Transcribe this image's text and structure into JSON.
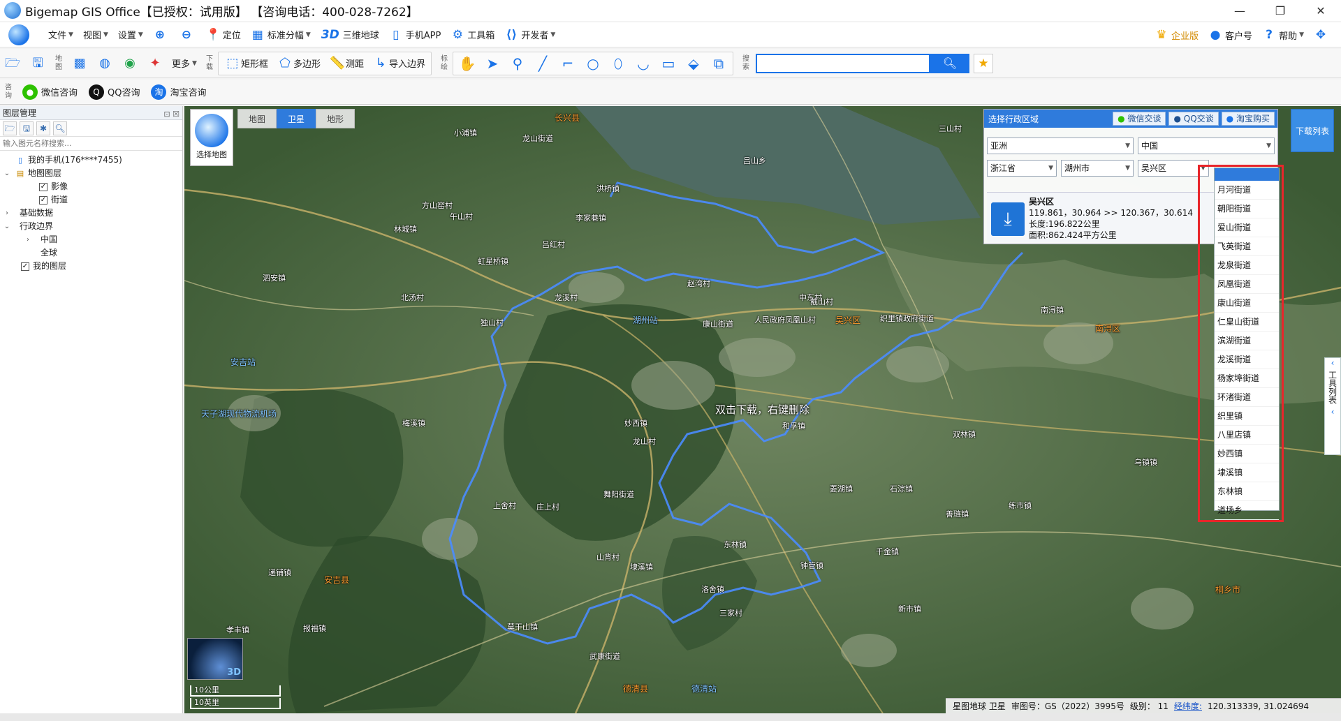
{
  "titlebar": {
    "title": "Bigemap GIS Office【已授权：试用版】 【咨询电话：400-028-7262】"
  },
  "menubar": {
    "items": [
      {
        "label": "文件"
      },
      {
        "label": "视图"
      },
      {
        "label": "设置"
      }
    ],
    "tools": [
      {
        "label": "定位"
      },
      {
        "label": "标准分幅"
      },
      {
        "label": "三维地球"
      },
      {
        "label": "手机APP"
      },
      {
        "label": "工具箱"
      },
      {
        "label": "开发者"
      }
    ],
    "right": [
      {
        "label": "企业版"
      },
      {
        "label": "客户号"
      },
      {
        "label": "帮助"
      }
    ]
  },
  "toolbar1": {
    "map_label": "地图",
    "more_label": "更多",
    "download_label": "下载",
    "annotate_label": "标绘",
    "search_label": "搜索",
    "rect_label": "矩形框",
    "polygon_label": "多边形",
    "measure_label": "测距",
    "import_label": "导入边界",
    "search_placeholder": ""
  },
  "toolbar2": {
    "consult_label": "咨询",
    "wechat": "微信咨询",
    "qq": "QQ咨询",
    "taobao": "淘宝咨询"
  },
  "layerpanel": {
    "title": "图层管理",
    "search_placeholder": "输入图元名称搜索...",
    "tree": [
      {
        "label": "我的手机(176****7455)"
      },
      {
        "label": "地图图层"
      },
      {
        "label": "影像"
      },
      {
        "label": "街道"
      },
      {
        "label": "基础数据"
      },
      {
        "label": "行政边界"
      },
      {
        "label": "中国"
      },
      {
        "label": "全球"
      },
      {
        "label": "我的图层"
      }
    ]
  },
  "map": {
    "selector_label": "选择地图",
    "tabs": [
      {
        "label": "地图"
      },
      {
        "label": "卫星"
      },
      {
        "label": "地形"
      }
    ],
    "download_list": "下载列表",
    "hint": "双击下载，右键删除",
    "right_tools": "工具列表",
    "scale": [
      "10公里",
      "10英里"
    ],
    "minimap_label": "3D",
    "labels": [
      {
        "t": "长兴县",
        "k": "town"
      },
      {
        "t": "吴兴区",
        "k": "town"
      },
      {
        "t": "南浔区",
        "k": "town"
      },
      {
        "t": "安吉县",
        "k": "town"
      },
      {
        "t": "德清县",
        "k": "town"
      },
      {
        "t": "桐乡市",
        "k": "town"
      },
      {
        "t": "湖州站",
        "k": "station"
      },
      {
        "t": "安吉站",
        "k": "station"
      },
      {
        "t": "德清站",
        "k": "station"
      },
      {
        "t": "天子湖现代物流机场",
        "k": "station"
      },
      {
        "t": "小浦镇"
      },
      {
        "t": "龙山街道"
      },
      {
        "t": "三山村"
      },
      {
        "t": "吕山乡"
      },
      {
        "t": "林城镇"
      },
      {
        "t": "李家巷镇"
      },
      {
        "t": "洪桥镇"
      },
      {
        "t": "方山窑村"
      },
      {
        "t": "午山村"
      },
      {
        "t": "吕红村"
      },
      {
        "t": "虹星桥镇"
      },
      {
        "t": "泗安镇"
      },
      {
        "t": "北汤村"
      },
      {
        "t": "独山村"
      },
      {
        "t": "龙溪村"
      },
      {
        "t": "赵湾村"
      },
      {
        "t": "中东村"
      },
      {
        "t": "康山街道"
      },
      {
        "t": "人民政府凤凰山村"
      },
      {
        "t": "戴山村"
      },
      {
        "t": "织里镇政府街道"
      },
      {
        "t": "南浔镇"
      },
      {
        "t": "梅溪镇"
      },
      {
        "t": "妙西镇"
      },
      {
        "t": "和孚镇"
      },
      {
        "t": "双林镇"
      },
      {
        "t": "千金镇"
      },
      {
        "t": "菱湖镇"
      },
      {
        "t": "石淙镇"
      },
      {
        "t": "练市镇"
      },
      {
        "t": "东林镇"
      },
      {
        "t": "钟管镇"
      },
      {
        "t": "洛舍镇"
      },
      {
        "t": "莫干山镇"
      },
      {
        "t": "新市镇"
      },
      {
        "t": "乌镇镇"
      },
      {
        "t": "善琏镇"
      },
      {
        "t": "埭溪镇"
      },
      {
        "t": "龙山村"
      },
      {
        "t": "上舍村"
      },
      {
        "t": "庄上村"
      },
      {
        "t": "山背村"
      },
      {
        "t": "三家村"
      },
      {
        "t": "武康街道"
      },
      {
        "t": "舞阳街道"
      },
      {
        "t": "递铺镇"
      },
      {
        "t": "孝丰镇"
      },
      {
        "t": "报福镇"
      }
    ]
  },
  "region_panel": {
    "title": "选择行政区域",
    "btn_wechat": "微信交谈",
    "btn_qq": "QQ交谈",
    "btn_taobao": "淘宝购买",
    "continent": "亚洲",
    "country": "中国",
    "province": "浙江省",
    "city": "湖州市",
    "district": "吴兴区",
    "info_name": "吴兴区",
    "info_coords": "119.861，30.964 >> 120.367，30.614",
    "info_length": "长度:196.822公里",
    "info_area": "面积:862.424平方公里"
  },
  "district_dropdown": {
    "options": [
      "月河街道",
      "朝阳街道",
      "爱山街道",
      "飞英街道",
      "龙泉街道",
      "凤凰街道",
      "康山街道",
      "仁皇山街道",
      "滨湖街道",
      "龙溪街道",
      "杨家埠街道",
      "环渚街道",
      "织里镇",
      "八里店镇",
      "妙西镇",
      "埭溪镇",
      "东林镇",
      "道场乡"
    ]
  },
  "statusbar": {
    "source": "星图地球 卫星",
    "license": "审图号：GS（2022）3995号",
    "level": "级别： 11",
    "coord_label": "经纬度:",
    "coords": "120.313339, 31.024694"
  },
  "colors": {
    "accent": "#2f7bdc",
    "highlight": "#e8262b",
    "boundary": "#4a8cff"
  }
}
